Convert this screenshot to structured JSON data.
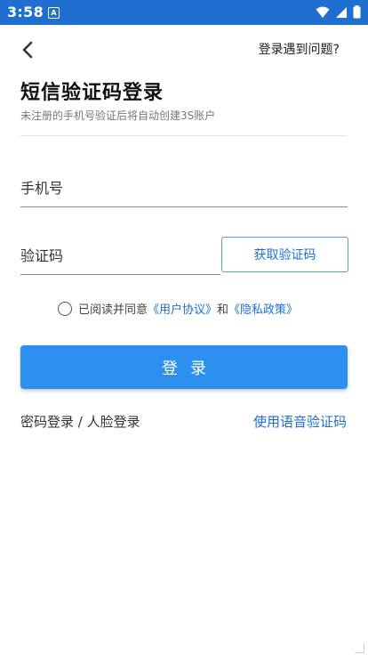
{
  "status_bar": {
    "time": "3:58",
    "notification_glyph": "A",
    "icons": [
      "wifi-icon",
      "signal-icon",
      "battery-icon"
    ]
  },
  "header": {
    "back_icon": "chevron-left-icon",
    "help_link": "登录遇到问题?"
  },
  "main": {
    "title": "短信验证码登录",
    "subtitle": "未注册的手机号验证后将自动创建3S账户",
    "phone_placeholder": "手机号",
    "code_placeholder": "验证码",
    "get_code_button": "获取验证码",
    "agreement": {
      "prefix": "已阅读并同意",
      "user_agreement": "《用户协议》",
      "conjunction": "和",
      "privacy_policy": "《隐私政策》",
      "checked": false
    },
    "login_button": "登录",
    "password_login": "密码登录",
    "separator": " / ",
    "face_login": "人脸登录",
    "voice_code": "使用语音验证码"
  },
  "colors": {
    "status_bar": "#1f6fd1",
    "accent": "#2d8ff0",
    "link": "#1f6fd1"
  }
}
